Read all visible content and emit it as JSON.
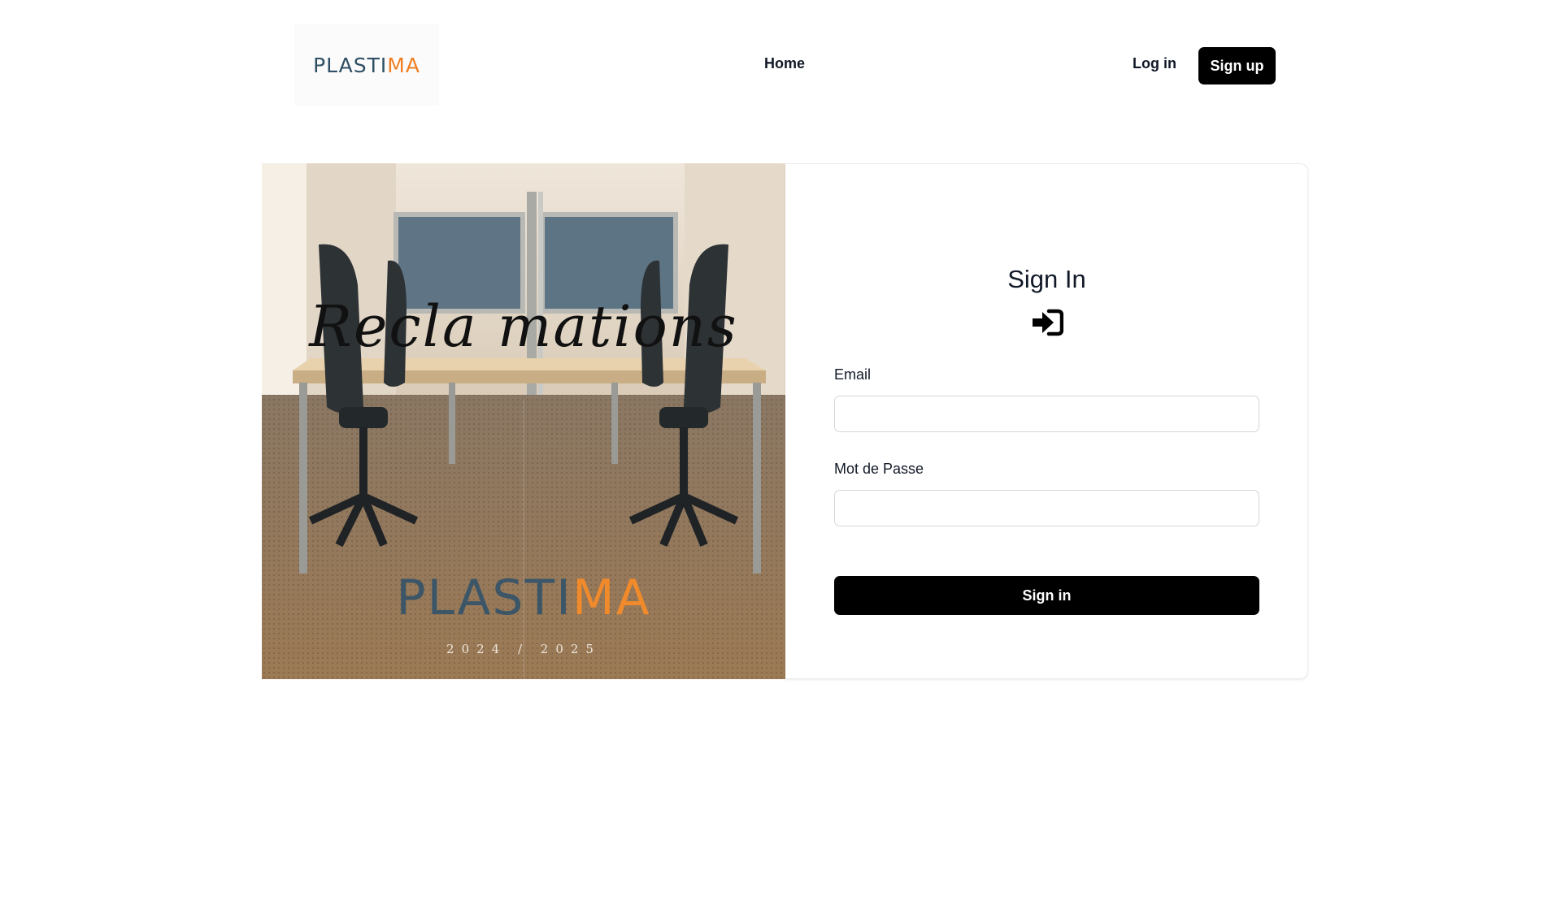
{
  "header": {
    "logo": {
      "part1": "PLASTI",
      "part2": "MA"
    },
    "nav": {
      "home": "Home"
    },
    "auth": {
      "login": "Log in",
      "signup": "Sign up"
    }
  },
  "poster": {
    "title": "Recla  mations",
    "brand": {
      "part1": "PLASTI",
      "part2": "MA"
    },
    "year": "2024 / 2025"
  },
  "form": {
    "title": "Sign In",
    "icon": "sign-in-icon",
    "email_label": "Email",
    "email_value": "",
    "password_label": "Mot de Passe",
    "password_value": "",
    "submit_label": "Sign in"
  },
  "colors": {
    "brand_blue": "#2f4f64",
    "brand_orange": "#ee7f22",
    "primary_button": "#000000"
  }
}
